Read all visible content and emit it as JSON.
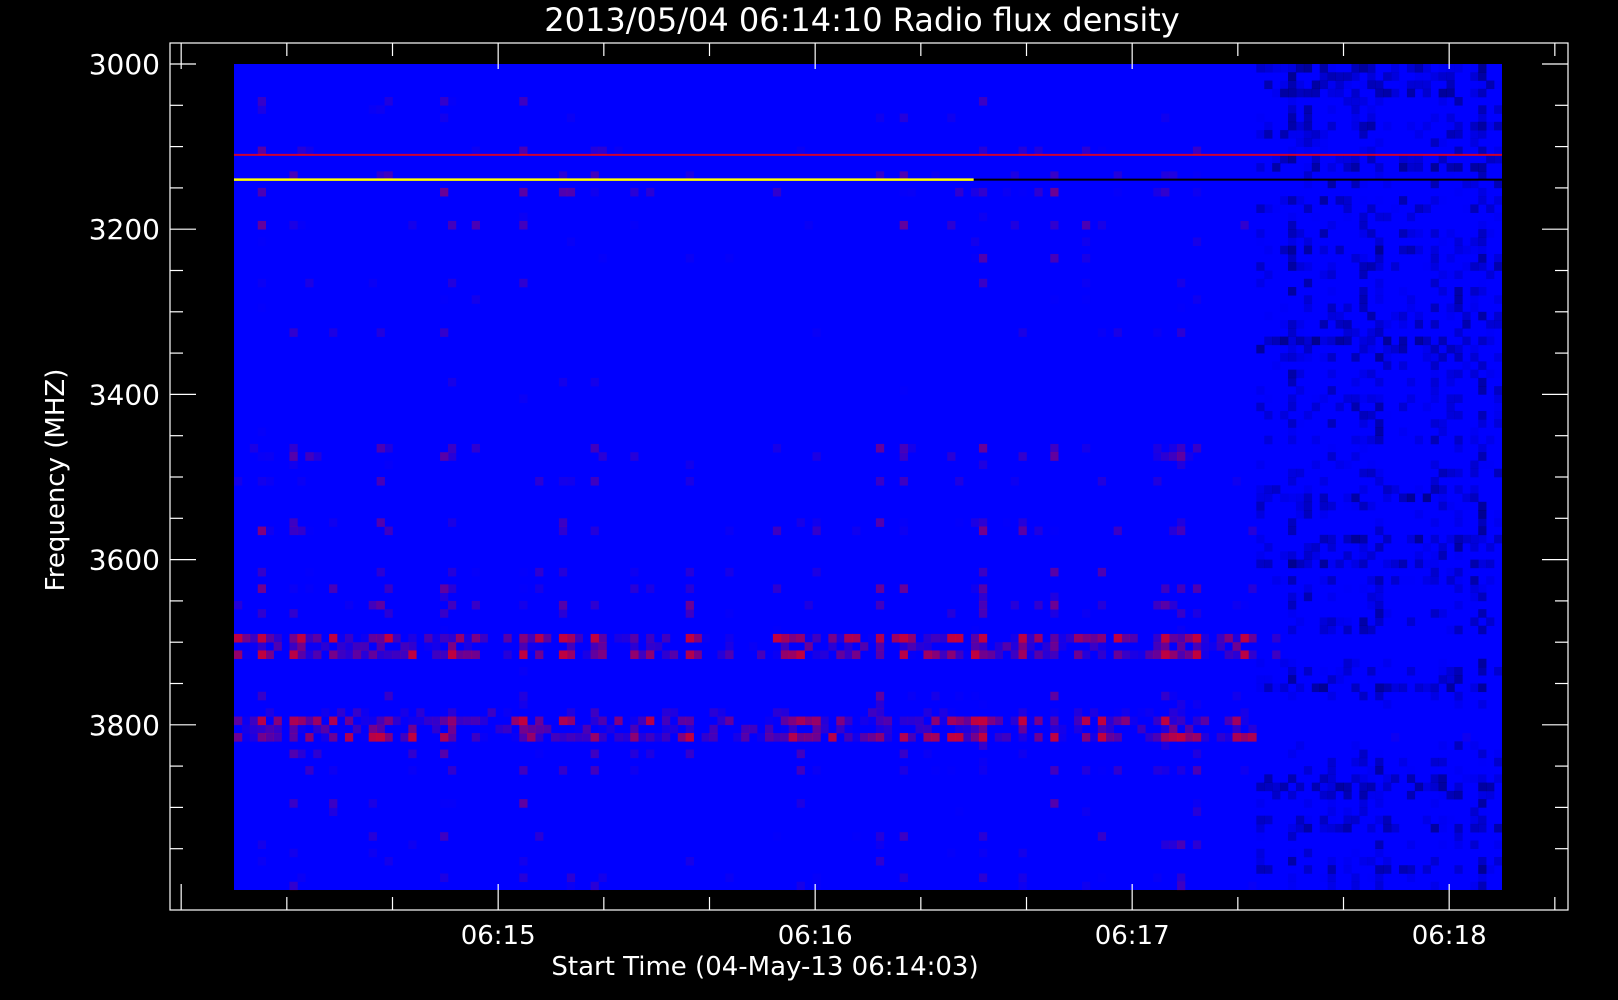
{
  "chart_data": {
    "type": "heatmap",
    "title": "2013/05/04 06:14:10 Radio flux density",
    "xlabel": "Start Time (04-May-13 06:14:03)",
    "ylabel": "Frequency (MHZ)",
    "x_major_ticks": [
      "06:15",
      "06:16",
      "06:17",
      "06:18"
    ],
    "y_major_ticks": [
      3000,
      3200,
      3400,
      3600,
      3800
    ],
    "ylim": [
      4000,
      3000
    ],
    "y_inverted": true,
    "data_extent": {
      "time_start": "06:14:10",
      "time_end": "06:18:10",
      "freq_min": 3000,
      "freq_max": 4000
    },
    "colormap": [
      "#000000",
      "#0000ff",
      "#ff0000",
      "#ffff00"
    ],
    "background_color": "#0000ff"
  }
}
